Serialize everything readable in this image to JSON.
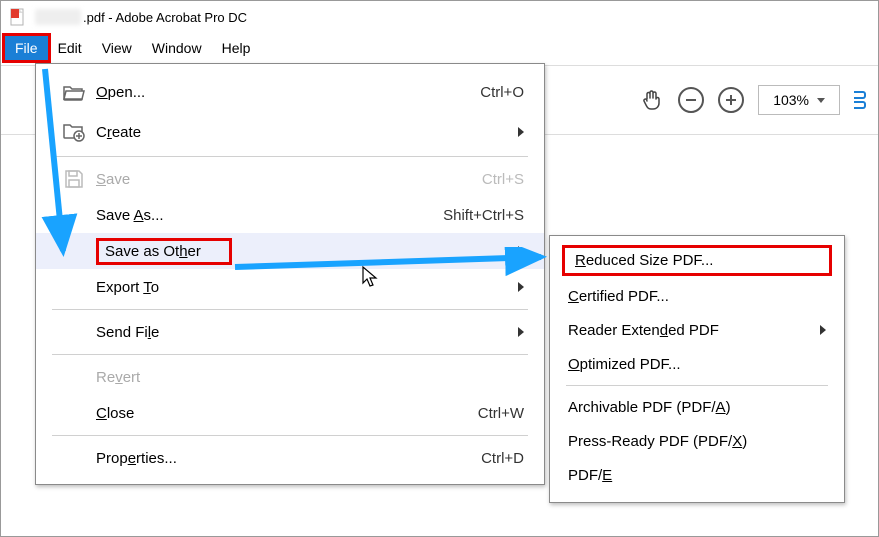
{
  "title": {
    "filename_suffix": ".pdf",
    "app": "Adobe Acrobat Pro DC"
  },
  "menubar": [
    "File",
    "Edit",
    "View",
    "Window",
    "Help"
  ],
  "file_menu": {
    "open": {
      "label": "Open...",
      "hint": "Ctrl+O",
      "mnemonic": "O"
    },
    "create": {
      "label": "Create",
      "mnemonic": "r"
    },
    "save": {
      "label": "Save",
      "hint": "Ctrl+S",
      "mnemonic": "S"
    },
    "save_as": {
      "label": "Save As...",
      "hint": "Shift+Ctrl+S",
      "mnemonic": "A"
    },
    "save_other": {
      "label": "Save as Other",
      "mnemonic": "h"
    },
    "export": {
      "label": "Export To",
      "mnemonic": "T"
    },
    "send": {
      "label": "Send File",
      "mnemonic": "l"
    },
    "revert": {
      "label": "Revert",
      "mnemonic": "v"
    },
    "close": {
      "label": "Close",
      "hint": "Ctrl+W",
      "mnemonic": "C"
    },
    "properties": {
      "label": "Properties...",
      "hint": "Ctrl+D",
      "mnemonic": "e"
    }
  },
  "submenu": {
    "reduced": {
      "label": "Reduced Size PDF...",
      "mnemonic": "R"
    },
    "certified": {
      "label": "Certified PDF...",
      "mnemonic": "C"
    },
    "reader": {
      "label": "Reader Extended PDF",
      "mnemonic": "d"
    },
    "optimized": {
      "label": "Optimized PDF...",
      "mnemonic": "O"
    },
    "archivable": {
      "label": "Archivable PDF (PDF/A)",
      "mnemonic": "A"
    },
    "press": {
      "label": "Press-Ready PDF (PDF/X)",
      "mnemonic": "X"
    },
    "pdfe": {
      "label": "PDF/E",
      "mnemonic": "E"
    }
  },
  "toolbar": {
    "zoom_value": "103%"
  },
  "annotations": {
    "highlight_color": "#e60000",
    "arrow_color": "#19a3ff"
  }
}
